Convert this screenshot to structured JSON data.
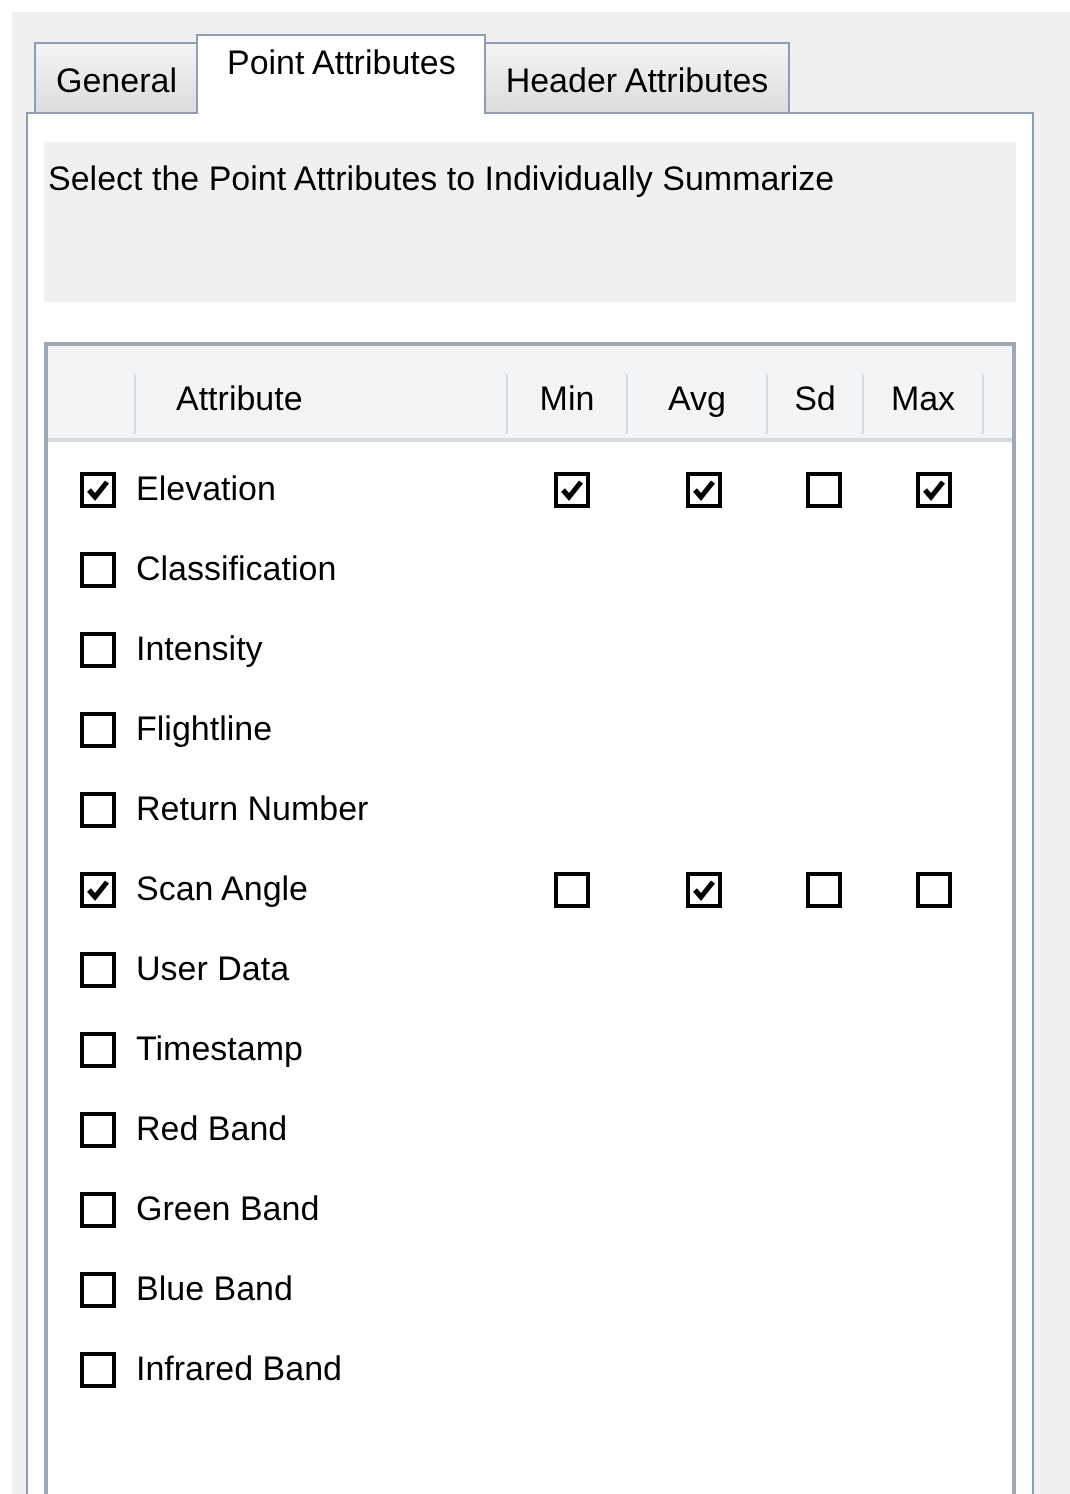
{
  "tabs": [
    {
      "label": "General",
      "selected": false
    },
    {
      "label": "Point Attributes",
      "selected": true
    },
    {
      "label": "Header Attributes",
      "selected": false
    }
  ],
  "description": "Select the Point Attributes to Individually Summarize",
  "table": {
    "columns": [
      "Attribute",
      "Min",
      "Avg",
      "Sd",
      "Max"
    ],
    "rows": [
      {
        "name": "Elevation",
        "checked": true,
        "stats": [
          {
            "checked": true
          },
          {
            "checked": true
          },
          {
            "checked": false
          },
          {
            "checked": true
          }
        ]
      },
      {
        "name": "Classification",
        "checked": false
      },
      {
        "name": "Intensity",
        "checked": false
      },
      {
        "name": "Flightline",
        "checked": false
      },
      {
        "name": "Return Number",
        "checked": false
      },
      {
        "name": "Scan Angle",
        "checked": true,
        "stats": [
          {
            "checked": false
          },
          {
            "checked": true
          },
          {
            "checked": false
          },
          {
            "checked": false
          }
        ]
      },
      {
        "name": "User Data",
        "checked": false
      },
      {
        "name": "Timestamp",
        "checked": false
      },
      {
        "name": "Red Band",
        "checked": false
      },
      {
        "name": "Green Band",
        "checked": false
      },
      {
        "name": "Blue Band",
        "checked": false
      },
      {
        "name": "Infrared Band",
        "checked": false
      }
    ]
  }
}
